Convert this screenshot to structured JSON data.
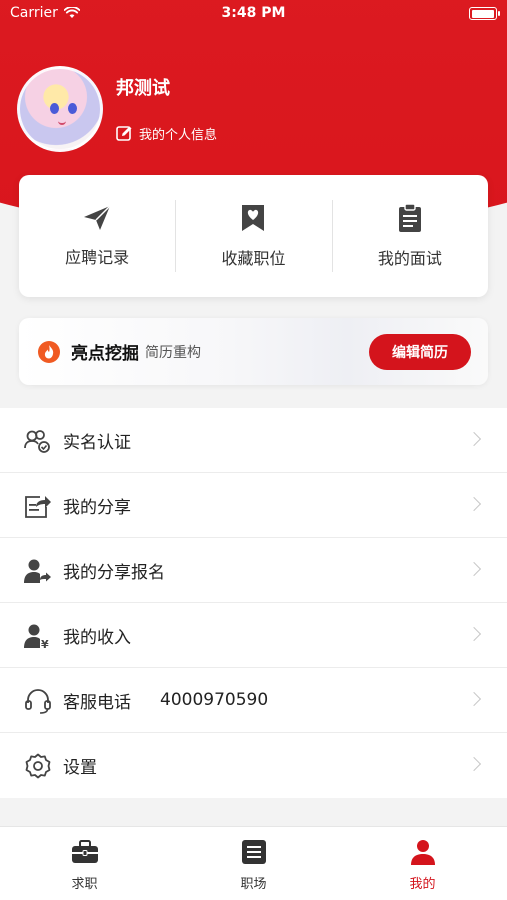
{
  "status_bar": {
    "carrier": "Carrier",
    "time": "3:48 PM"
  },
  "profile": {
    "name": "邦测试",
    "link_label": "我的个人信息"
  },
  "quick_actions": [
    {
      "label": "应聘记录",
      "icon": "paper-plane-icon"
    },
    {
      "label": "收藏职位",
      "icon": "bookmark-heart-icon"
    },
    {
      "label": "我的面试",
      "icon": "clipboard-icon"
    }
  ],
  "banner": {
    "title": "亮点挖掘",
    "subtitle": "简历重构",
    "button": "编辑简历",
    "icon": "flame-icon"
  },
  "menu": [
    {
      "label": "实名认证",
      "value": "",
      "icon": "verify-user-icon"
    },
    {
      "label": "我的分享",
      "value": "",
      "icon": "share-icon"
    },
    {
      "label": "我的分享报名",
      "value": "",
      "icon": "user-share-icon"
    },
    {
      "label": "我的收入",
      "value": "",
      "icon": "user-income-icon"
    },
    {
      "label": "客服电话",
      "value": "4000970590",
      "icon": "headset-icon"
    },
    {
      "label": "设置",
      "value": "",
      "icon": "gear-icon"
    }
  ],
  "tabs": [
    {
      "label": "求职",
      "icon": "briefcase-icon",
      "active": false
    },
    {
      "label": "职场",
      "icon": "list-icon",
      "active": false
    },
    {
      "label": "我的",
      "icon": "person-icon",
      "active": true
    }
  ],
  "colors": {
    "brand": "#d4141c",
    "inactive": "#333333"
  }
}
